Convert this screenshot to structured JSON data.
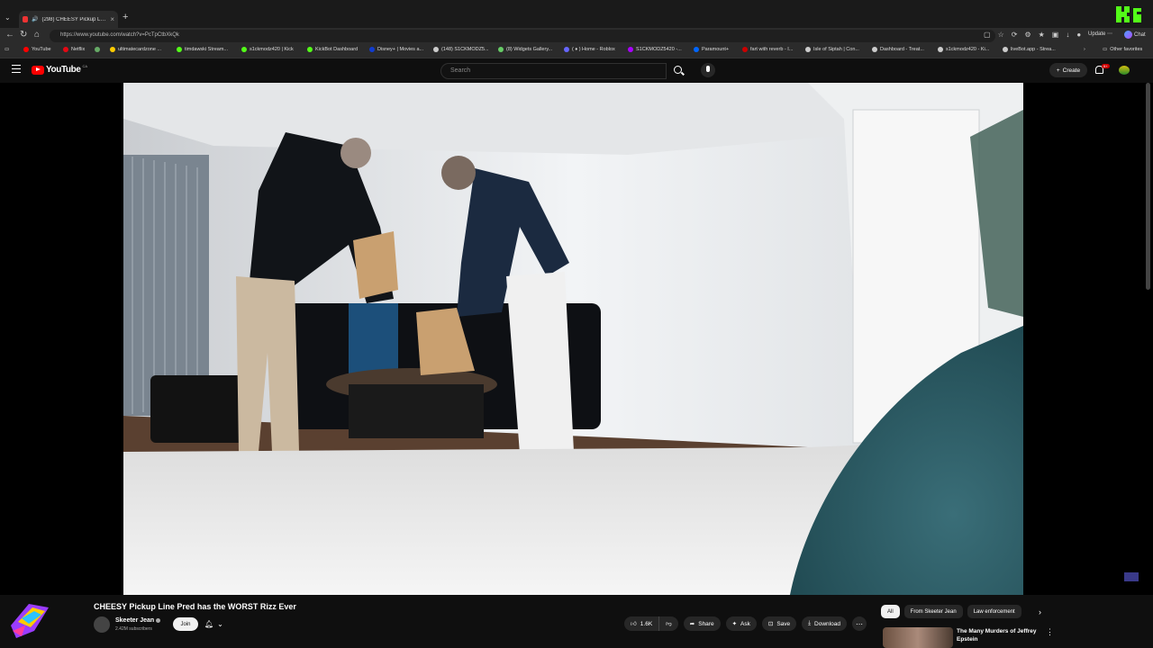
{
  "browser": {
    "tab_title": "(298) CHEESY Pickup Line Pre",
    "new_tab": "+",
    "url": "https://www.youtube.com/watch?v=PcTpCtbXkQk",
    "update_label": "Update",
    "chat_label": "Chat",
    "favorites": [
      "YouTube",
      "Netflix",
      "ultimatecardzone ...",
      "timdawski Stream...",
      "s1ckmodz420 | Kick",
      "KickBot Dashboard",
      "Disney+ | Movies a...",
      "(148) S1CKMODZ5...",
      "(8) Widgets Gallery...",
      "( ♦ ) Home - Roblox",
      "S1CKMODZ5420 -...",
      "Paramount+",
      "fart with reverb - I...",
      "Isle of Siptah | Con...",
      "Dashboard - Treat...",
      "s1ckmodz420 - Ki...",
      "liveBot.app - Strea..."
    ],
    "other_favorites": "Other favorites"
  },
  "youtube": {
    "logo_text": "YouTube",
    "country_code": "CA",
    "search_placeholder": "Search",
    "create_label": "Create",
    "notification_count": "9+"
  },
  "video": {
    "title": "CHEESY Pickup Line Pred has the WORST Rizz Ever",
    "channel_name": "Skeeter Jean",
    "subscribers": "2.42M subscribers",
    "join_label": "Join",
    "like_count": "1.6K",
    "share_label": "Share",
    "ask_label": "Ask",
    "save_label": "Save",
    "download_label": "Download"
  },
  "sidebar": {
    "chips": [
      "All",
      "From Skeeter Jean",
      "Law enforcement"
    ],
    "recommended_title": "The Many Murders of Jeffrey Epstein"
  },
  "colors": {
    "background": "#0f0f0f",
    "youtube_red": "#ff0000",
    "pill_bg": "#272727"
  }
}
